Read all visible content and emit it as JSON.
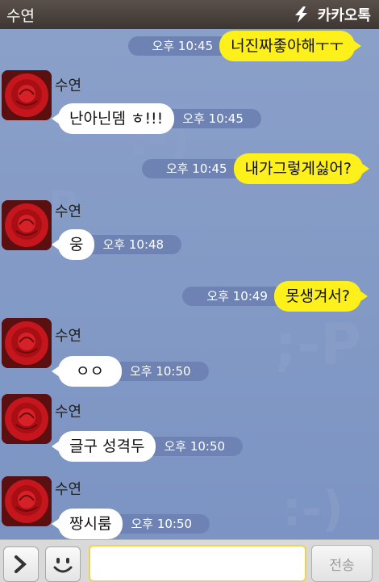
{
  "header": {
    "contact_name": "수연",
    "brand": "카카오톡"
  },
  "messages": [
    {
      "from": "me",
      "text": "너진짜좋아해ㅜㅜ",
      "time": "오후 10:45"
    },
    {
      "from": "them",
      "sender": "수연",
      "text": "난아닌뎀 ㅎ!!!",
      "time": "오후 10:45"
    },
    {
      "from": "me",
      "text": "내가그렇게싫어?",
      "time": "오후 10:45"
    },
    {
      "from": "them",
      "sender": "수연",
      "text": "웅",
      "time": "오후 10:48"
    },
    {
      "from": "me",
      "text": "못생겨서?",
      "time": "오후 10:49"
    },
    {
      "from": "them",
      "sender": "수연",
      "text": "ㅇㅇ",
      "time": "오후 10:50"
    },
    {
      "from": "them",
      "sender": "수연",
      "text": "글구 성격두",
      "time": "오후 10:50"
    },
    {
      "from": "them",
      "sender": "수연",
      "text": "짱시룸",
      "time": "오후 10:50"
    }
  ],
  "input_bar": {
    "expand_icon": "chevron-right-icon",
    "emoticon_icon": "smiley-icon",
    "send_label": "전송",
    "message_value": ""
  },
  "colors": {
    "my_bubble": "#fef01b",
    "their_bubble": "#ffffff",
    "chat_bg": "#7f96c5"
  }
}
